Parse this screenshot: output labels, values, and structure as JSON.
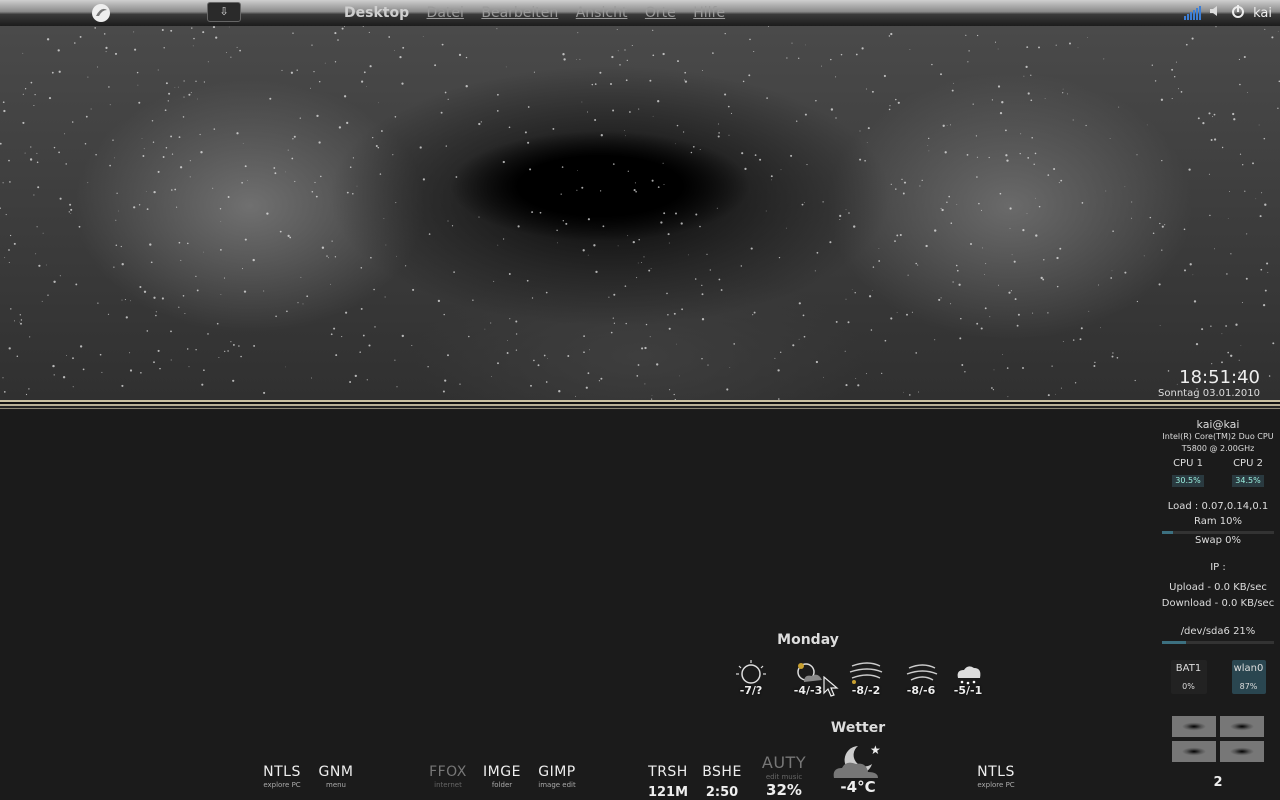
{
  "panel": {
    "menu": [
      "Desktop",
      "Datei",
      "Bearbeiten",
      "Ansicht",
      "Orte",
      "Hilfe"
    ],
    "user": "kai"
  },
  "clock": {
    "time": "18:51:40",
    "date": "Sonntag 03.01.2010"
  },
  "sysmon": {
    "host": "kai@kai",
    "cpu_model_1": "Intel(R) Core(TM)2 Duo CPU",
    "cpu_model_2": "T5800  @ 2.00GHz",
    "cpu1_label": "CPU 1",
    "cpu1_value": "30.5%",
    "cpu2_label": "CPU 2",
    "cpu2_value": "34.5%",
    "load": "Load : 0.07,0.14,0.1",
    "ram": "Ram 10%",
    "ram_pct": 10,
    "swap": "Swap 0%",
    "ip": "IP :",
    "upload": "Upload - 0.0 KB/sec",
    "download": "Download - 0.0 KB/sec",
    "disk": "/dev/sda6 21%",
    "disk_pct": 21,
    "bat_label": "BAT1",
    "bat_value": "0%",
    "wlan_label": "wlan0",
    "wlan_value": "87%",
    "workspace": "2"
  },
  "weather": {
    "day": "Monday",
    "forecast": [
      "-7/?",
      "-4/-3",
      "-8/-2",
      "-8/-6",
      "-5/-1"
    ],
    "title": "Wetter",
    "current": "-4°C"
  },
  "dock": [
    {
      "label": "NTLS",
      "sub": "explore PC"
    },
    {
      "label": "GNM",
      "sub": "menu"
    },
    {
      "label": "FFOX",
      "sub": "internet"
    },
    {
      "label": "IMGE",
      "sub": "folder"
    },
    {
      "label": "GIMP",
      "sub": "image edit"
    },
    {
      "label": "TRSH",
      "value": "121M"
    },
    {
      "label": "BSHE",
      "value": "2:50"
    },
    {
      "label": "AUTY",
      "sub": "edit music",
      "value": "32%"
    },
    {
      "label": "NTLS",
      "sub": "explore PC"
    }
  ]
}
